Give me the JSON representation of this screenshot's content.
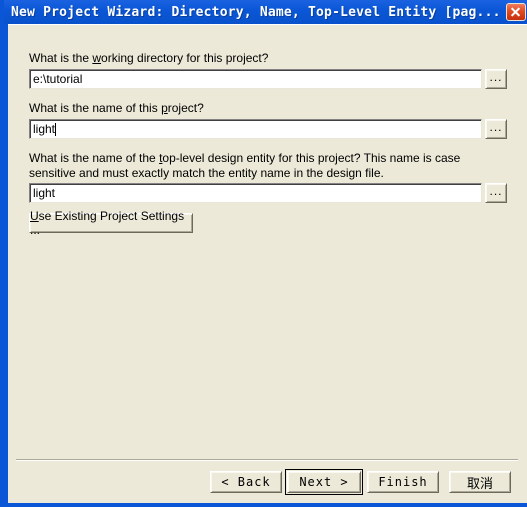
{
  "window": {
    "title": "New Project Wizard: Directory, Name, Top-Level Entity [pag...",
    "close_icon": "close-icon",
    "colors": {
      "titlebar": "#0a56d6",
      "client": "#ece9d8",
      "close_button": "#e24a20",
      "text": "#000000",
      "input_background": "#ffffff"
    }
  },
  "fields": [
    {
      "label_before": "What is the ",
      "label_accel": "w",
      "label_after": "orking directory for this project?",
      "value": "e:\\tutorial",
      "browse_label": "...",
      "has_caret": false
    },
    {
      "label_before": "What is the name of this ",
      "label_accel": "p",
      "label_after": "roject?",
      "value": "light",
      "browse_label": "...",
      "has_caret": true
    },
    {
      "label_before": "What is the name of the ",
      "label_accel": "t",
      "label_after": "op-level design entity for this project? This name is case sensitive and must exactly match the entity name in the design file.",
      "value": "light",
      "browse_label": "...",
      "has_caret": false
    }
  ],
  "use_existing": {
    "label_before": "",
    "label_accel": "U",
    "label_after": "se Existing Project Settings ..."
  },
  "buttons": {
    "back": "< Back",
    "next": "Next >",
    "finish": "Finish",
    "cancel": "取消"
  }
}
